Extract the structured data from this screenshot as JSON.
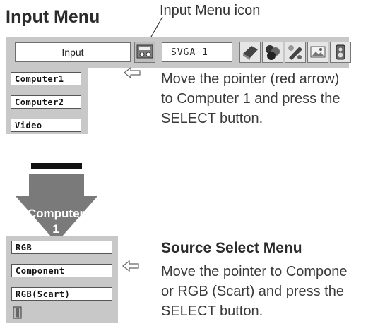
{
  "heading_input_menu": "Input Menu",
  "callout_icon_label": "Input Menu icon",
  "menu_bar": {
    "lead_label": "Input",
    "mode_label": "SVGA 1",
    "icons": [
      "input-menu-icon",
      "display-icon",
      "color-icon",
      "adjust-icon",
      "image-icon",
      "sound-icon"
    ]
  },
  "input_menu": {
    "items": [
      "Computer1",
      "Computer2",
      "Video"
    ]
  },
  "text_step1": [
    "Move the pointer (red arrow)",
    "to Computer 1 and press the",
    "SELECT button."
  ],
  "arrow_label": [
    "Computer",
    "1"
  ],
  "source_menu": {
    "items": [
      "RGB",
      "Component",
      "RGB(Scart)"
    ]
  },
  "heading_source_select": "Source Select Menu",
  "text_step2": [
    "Move the pointer to Compone",
    "or RGB (Scart) and press the",
    "SELECT button."
  ],
  "colors": {
    "menu_gray": "#c8c8c8",
    "arrow_gray": "#7a7a7a",
    "text": "#3a3a3a"
  }
}
